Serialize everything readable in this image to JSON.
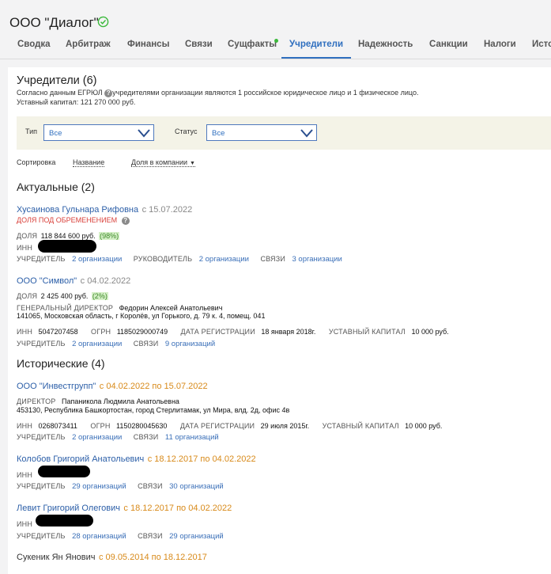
{
  "company": {
    "title": "ООО \"Диалог\""
  },
  "tabs": [
    {
      "label": "Сводка"
    },
    {
      "label": "Арбитраж"
    },
    {
      "label": "Финансы"
    },
    {
      "label": "Связи"
    },
    {
      "label": "Сущфакты"
    },
    {
      "label": "Учредители"
    },
    {
      "label": "Надежность"
    },
    {
      "label": "Санкции"
    },
    {
      "label": "Налоги"
    },
    {
      "label": "Исто"
    }
  ],
  "founders": {
    "title": "Учредители (6)",
    "desc_pre": "Согласно данным ЕГРЮЛ",
    "desc_post": "учредителями организации являются 1 российское юридическое лицо и 1 физическое лицо.",
    "capital": "Уставный капитал: 121 270 000 руб."
  },
  "filters": {
    "type_label": "Тип",
    "type_value": "Все",
    "status_label": "Статус",
    "status_value": "Все"
  },
  "sort": {
    "label": "Сортировка",
    "by_name": "Название",
    "by_share": "Доля в компании"
  },
  "current": {
    "title": "Актуальные (2)",
    "items": [
      {
        "name": "Хусаинова Гульнара Рифовна",
        "date": "с 15.07.2022",
        "encumbrance": "ДОЛЯ ПОД ОБРЕМЕНЕНИЕМ",
        "share_label": "ДОЛЯ",
        "share_value": "118 844 600 руб.",
        "share_pct": "(98%)",
        "inn_label": "ИНН",
        "founder_label": "УЧРЕДИТЕЛЬ",
        "founder_link": "2 организации",
        "manager_label": "РУКОВОДИТЕЛЬ",
        "manager_link": "2 организации",
        "links_label": "СВЯЗИ",
        "links_link": "3 организации"
      },
      {
        "name": "ООО \"Символ\"",
        "date": "с 04.02.2022",
        "share_label": "ДОЛЯ",
        "share_value": "2 425 400 руб.",
        "share_pct": "(2%)",
        "director_label": "ГЕНЕРАЛЬНЫЙ ДИРЕКТОР",
        "director_value": "Федорин Алексей Анатольевич",
        "address": "141065, Московская область, г Королёв, ул Горького, д. 79 к. 4, помещ. 041",
        "inn_label": "ИНН",
        "inn_value": "5047207458",
        "ogrn_label": "ОГРН",
        "ogrn_value": "1185029000749",
        "reg_label": "ДАТА РЕГИСТРАЦИИ",
        "reg_value": "18 января 2018г.",
        "capital_label": "УСТАВНЫЙ КАПИТАЛ",
        "capital_value": "10 000 руб.",
        "founder_label": "УЧРЕДИТЕЛЬ",
        "founder_link": "2 организации",
        "links_label": "СВЯЗИ",
        "links_link": "9 организаций"
      }
    ]
  },
  "historical": {
    "title": "Исторические (4)",
    "items": [
      {
        "name": "ООО \"Инвестгрупп\"",
        "date": "с 04.02.2022 по 15.07.2022",
        "director_label": "ДИРЕКТОР",
        "director_value": "Папаникола Людмила Анатольевна",
        "address": "453130, Республика Башкортостан, город Стерлитамак, ул Мира, влд. 2д, офис 4в",
        "inn_label": "ИНН",
        "inn_value": "0268073411",
        "ogrn_label": "ОГРН",
        "ogrn_value": "1150280045630",
        "reg_label": "ДАТА РЕГИСТРАЦИИ",
        "reg_value": "29 июля 2015г.",
        "capital_label": "УСТАВНЫЙ КАПИТАЛ",
        "capital_value": "10 000 руб.",
        "founder_label": "УЧРЕДИТЕЛЬ",
        "founder_link": "2 организации",
        "links_label": "СВЯЗИ",
        "links_link": "11 организаций"
      },
      {
        "name": "Колобов Григорий Анатольевич",
        "date": "с 18.12.2017 по 04.02.2022",
        "inn_label": "ИНН",
        "founder_label": "УЧРЕДИТЕЛЬ",
        "founder_link": "29 организаций",
        "links_label": "СВЯЗИ",
        "links_link": "30 организаций"
      },
      {
        "name": "Левит Григорий Олегович",
        "date": "с 18.12.2017 по 04.02.2022",
        "inn_label": "ИНН",
        "founder_label": "УЧРЕДИТЕЛЬ",
        "founder_link": "28 организаций",
        "links_label": "СВЯЗИ",
        "links_link": "29 организаций"
      },
      {
        "name": "Сукеник Ян Янович",
        "date": "с 09.05.2014 по 18.12.2017"
      }
    ]
  },
  "colors": {
    "accent": "#2f6fbf",
    "verified": "#3cb93c",
    "warning": "#d9413b",
    "historical_date": "#d88a1a"
  }
}
